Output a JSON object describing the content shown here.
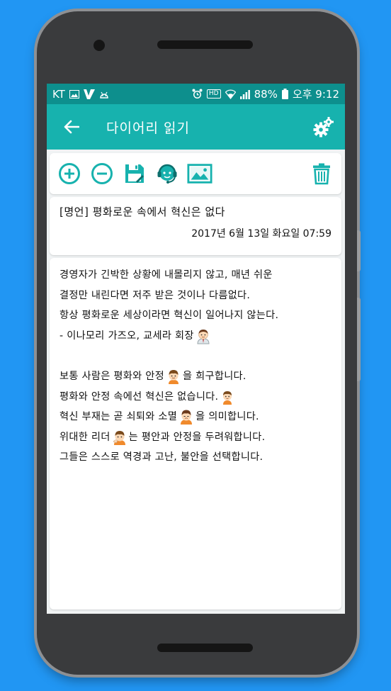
{
  "status_bar": {
    "carrier": "KT",
    "battery": "88%",
    "time": "오후 9:12",
    "hd_label": "HD"
  },
  "toolbar": {
    "title": "다이어리 읽기"
  },
  "diary": {
    "title": "[명언] 평화로운 속에서 혁신은 없다",
    "date": "2017년 6월 13일 화요일 07:59",
    "lines": [
      "경영자가 긴박한 상황에 내몰리지 않고, 매년 쉬운",
      "결정만 내린다면 저주 받은 것이나 다름없다.",
      "항상 평화로운 세상이라면 혁신이 일어나지 않는다.",
      "- 이나모리 가즈오, 교세라 회장",
      "",
      "보통 사람은 평화와 안정",
      "을 희구합니다.",
      "평화와 안정 속에선 혁신은 없습니다.",
      "혁신 부재는 곧 쇠퇴와 소멸",
      "을 의미합니다.",
      "위대한 리더",
      "는 평안과 안정을 두려워합니다.",
      "그들은 스스로 역경과 고난, 불안을 선택합니다."
    ]
  },
  "icons": {
    "back": "arrow-left-icon",
    "settings": "gears-icon",
    "add": "plus-circle-icon",
    "remove": "minus-circle-icon",
    "save": "floppy-disk-icon",
    "emoticon": "headset-face-icon",
    "image": "picture-icon",
    "delete": "trash-icon"
  },
  "colors": {
    "status_bar": "#0d8f8d",
    "toolbar": "#17b2ae",
    "accent": "#17b2ae",
    "background": "#2196F3"
  }
}
